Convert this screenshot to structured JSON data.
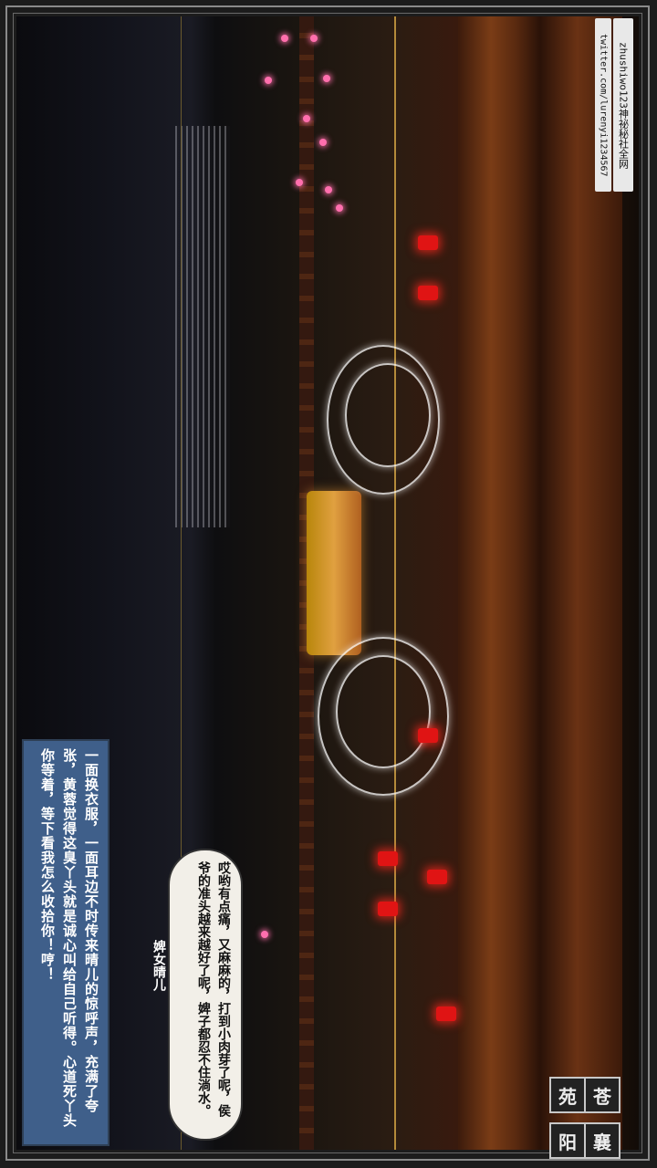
{
  "watermark": {
    "line1": "zhushiwo123神祕秘社全网",
    "line2": "twitter.com/lurenyi1234567"
  },
  "place": {
    "char1": "襄",
    "char2": "阳",
    "char3": "苍",
    "char4": "苑"
  },
  "narration": {
    "text": "一面换衣服，一面耳边不时传来晴儿的惊呼声，充满了夸张，黄蓉觉得这臭丫头就是诚心叫给自己听得。心道死丫头你等着，等下看我怎么收拾你！哼！"
  },
  "dialogue": {
    "speaker": "婢女晴儿",
    "text": "哎哟有点痛，又麻麻的，打到小肉芽了呢，侯爷的准头越来越好了呢，婢子都忍不住淌水。"
  }
}
